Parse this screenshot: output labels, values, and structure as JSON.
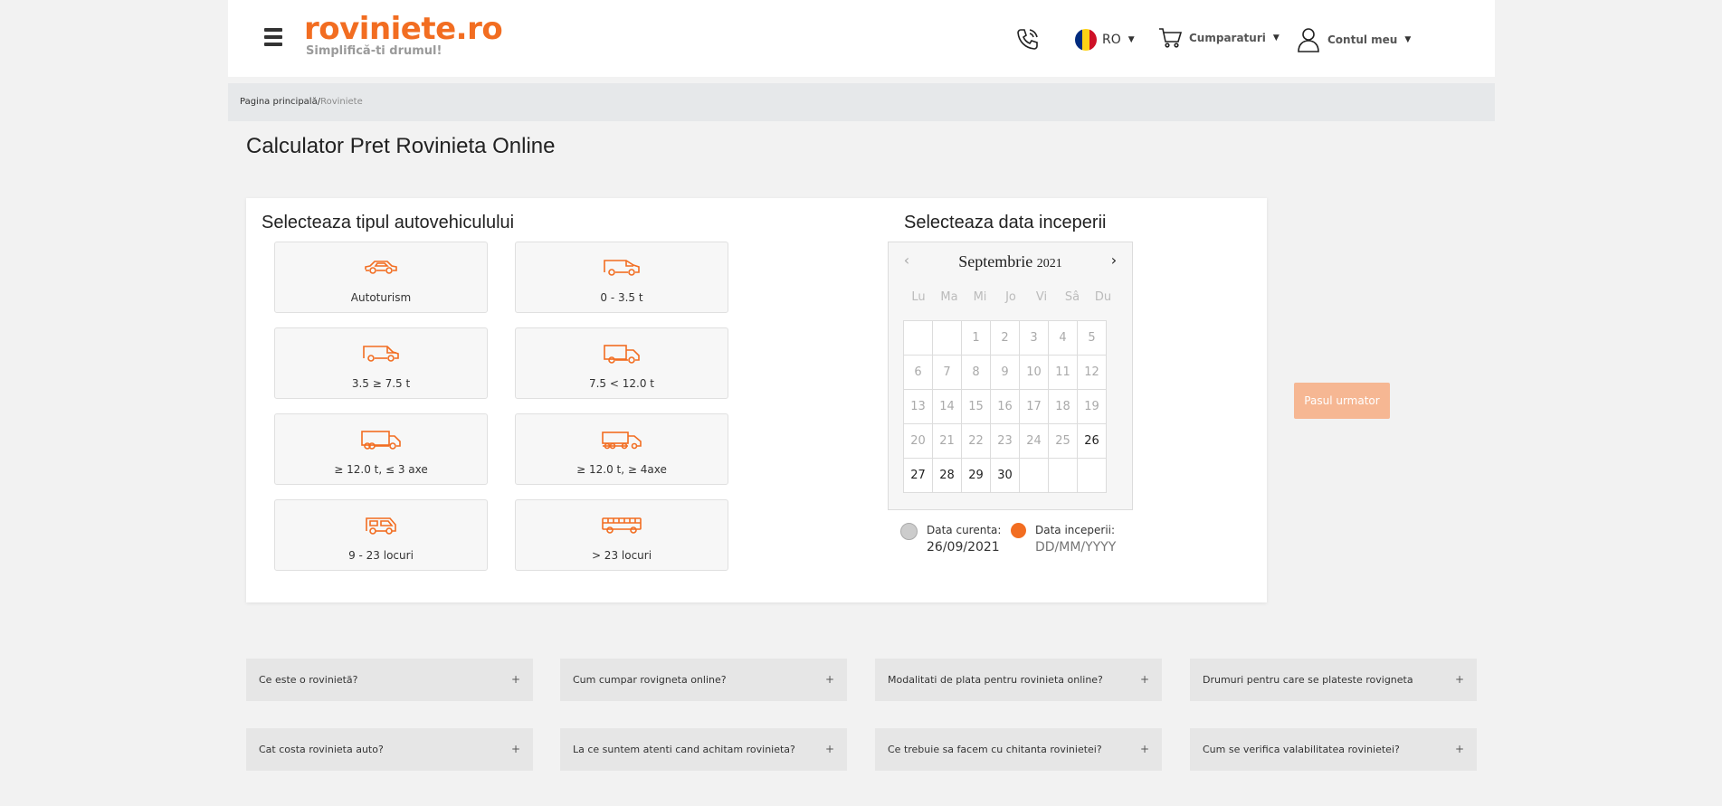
{
  "header": {
    "logo_text": "roviniete.ro",
    "logo_tagline": "Simplifică-ti drumul!",
    "language": "RO",
    "cart_label": "Cumparaturi",
    "account_label": "Contul meu",
    "flag_colors": [
      "#002b7f",
      "#fcd116",
      "#ce1126"
    ]
  },
  "breadcrumb": {
    "home": "Pagina principală",
    "separator": "/",
    "current": "Roviniete"
  },
  "page_title": "Calculator Pret Rovinieta Online",
  "vehicle_section": {
    "title": "Selecteaza tipul autovehiculului",
    "options": [
      {
        "label": "Autoturism",
        "icon": "car-icon"
      },
      {
        "label": "0 - 3.5 t",
        "icon": "van-icon"
      },
      {
        "label": "3.5 ≥ 7.5 t",
        "icon": "large-van-icon"
      },
      {
        "label": "7.5 < 12.0 t",
        "icon": "small-truck-icon"
      },
      {
        "label": "≥ 12.0 t, ≤ 3 axe",
        "icon": "truck-icon"
      },
      {
        "label": "≥ 12.0 t, ≥ 4axe",
        "icon": "semi-truck-icon"
      },
      {
        "label": "9 - 23 locuri",
        "icon": "minibus-icon"
      },
      {
        "label": "> 23 locuri",
        "icon": "bus-icon"
      }
    ]
  },
  "date_section": {
    "title": "Selecteaza data inceperii",
    "month": "Septembrie",
    "year": "2021",
    "weekdays": [
      "Lu",
      "Ma",
      "Mi",
      "Jo",
      "Vi",
      "Sâ",
      "Du"
    ],
    "weeks": [
      [
        "",
        "",
        "1",
        "2",
        "3",
        "4",
        "5"
      ],
      [
        "6",
        "7",
        "8",
        "9",
        "10",
        "11",
        "12"
      ],
      [
        "13",
        "14",
        "15",
        "16",
        "17",
        "18",
        "19"
      ],
      [
        "20",
        "21",
        "22",
        "23",
        "24",
        "25",
        "26"
      ],
      [
        "27",
        "28",
        "29",
        "30",
        "",
        "",
        ""
      ]
    ],
    "enabled_days": [
      "26",
      "27",
      "28",
      "29",
      "30"
    ],
    "current_label": "Data curenta:",
    "current_value": "26/09/2021",
    "start_label": "Data inceperii:",
    "start_placeholder": "DD/MM/YYYY",
    "current_color": "#cccccc",
    "start_color": "#f26d21"
  },
  "next_button": "Pasul urmator",
  "faq": [
    "Ce este o rovinietă?",
    "Cum cumpar rovigneta online?",
    "Modalitati de plata pentru rovinieta online?",
    "Drumuri pentru care se plateste rovigneta",
    "Cat costa rovinieta auto?",
    "La ce suntem atenti cand achitam rovinieta?",
    "Ce trebuie sa facem cu chitanta rovinietei?",
    "Cum se verifica valabilitatea rovinietei?"
  ],
  "faq_plus": "+",
  "colors": {
    "accent": "#f26d21",
    "button_disabled": "#f6b793"
  }
}
